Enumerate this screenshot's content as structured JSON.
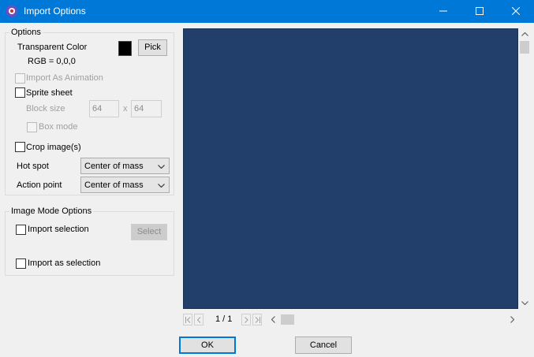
{
  "window": {
    "title": "Import Options"
  },
  "options_group": {
    "title": "Options",
    "transparent_color_label": "Transparent Color",
    "rgb_text": "RGB = 0,0,0",
    "swatch_color": "#000000",
    "pick_label": "Pick",
    "import_animation_label": "Import As Animation",
    "sprite_sheet_label": "Sprite sheet",
    "block_size_label": "Block size",
    "block_w": "64",
    "block_x": "x",
    "block_h": "64",
    "box_mode_label": "Box mode",
    "crop_label": "Crop image(s)",
    "hot_spot_label": "Hot spot",
    "hot_spot_value": "Center of mass",
    "action_point_label": "Action point",
    "action_point_value": "Center of mass"
  },
  "image_mode_group": {
    "title": "Image Mode Options",
    "import_selection_label": "Import selection",
    "select_label": "Select",
    "import_as_selection_label": "Import as selection"
  },
  "preview": {
    "background_color": "#223e6a",
    "page_indicator": "1 / 1"
  },
  "footer": {
    "ok_label": "OK",
    "cancel_label": "Cancel"
  }
}
